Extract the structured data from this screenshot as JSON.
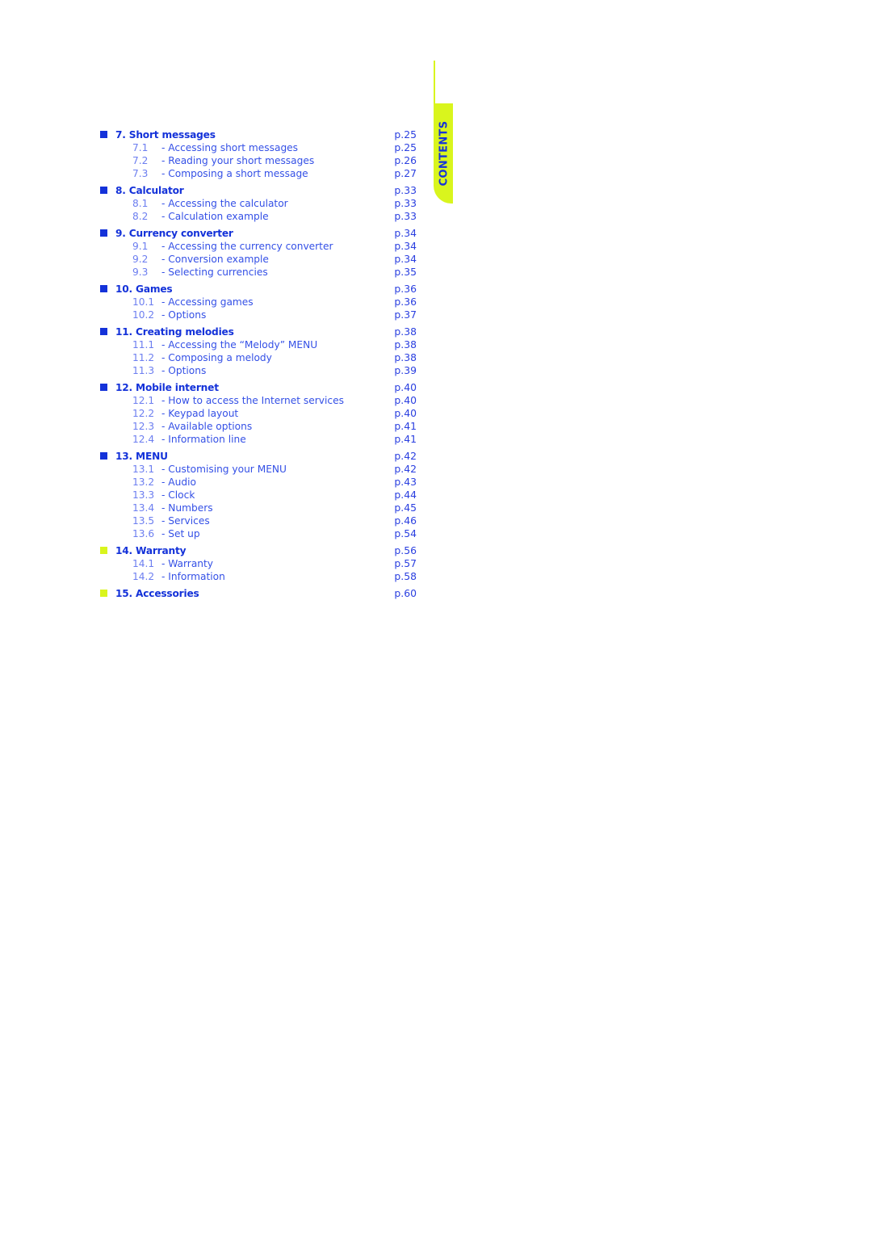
{
  "side_tab": {
    "label": "CONTENTS",
    "color": "#d9f51d",
    "text_color": "#1432d9"
  },
  "colors": {
    "primary_blue": "#1432d9",
    "sub_blue": "#3450e6",
    "accent_yellow": "#d9f51d"
  },
  "sections": [
    {
      "bullet": "blue",
      "title": "7. Short messages",
      "page": "p.25",
      "items": [
        {
          "num": "7.1",
          "label": "- Accessing short messages",
          "page": "p.25"
        },
        {
          "num": "7.2",
          "label": "- Reading your short messages",
          "page": "p.26"
        },
        {
          "num": "7.3",
          "label": "- Composing a short message",
          "page": "p.27"
        }
      ]
    },
    {
      "bullet": "blue",
      "title": "8. Calculator",
      "page": "p.33",
      "items": [
        {
          "num": "8.1",
          "label": "- Accessing the calculator",
          "page": "p.33"
        },
        {
          "num": "8.2",
          "label": "- Calculation example",
          "page": "p.33"
        }
      ]
    },
    {
      "bullet": "blue",
      "title": "9. Currency converter",
      "page": "p.34",
      "items": [
        {
          "num": "9.1",
          "label": "- Accessing the currency converter",
          "page": "p.34"
        },
        {
          "num": "9.2",
          "label": "- Conversion example",
          "page": "p.34"
        },
        {
          "num": "9.3",
          "label": "- Selecting currencies",
          "page": "p.35"
        }
      ]
    },
    {
      "bullet": "blue",
      "title": "10. Games",
      "page": "p.36",
      "items": [
        {
          "num": "10.1",
          "label": "- Accessing games",
          "page": "p.36"
        },
        {
          "num": "10.2",
          "label": "- Options",
          "page": "p.37"
        }
      ]
    },
    {
      "bullet": "blue",
      "title": "11. Creating melodies",
      "page": "p.38",
      "items": [
        {
          "num": "11.1",
          "label": "- Accessing the “Melody” MENU",
          "page": "p.38"
        },
        {
          "num": "11.2",
          "label": "- Composing a melody",
          "page": "p.38"
        },
        {
          "num": "11.3",
          "label": "- Options",
          "page": "p.39"
        }
      ]
    },
    {
      "bullet": "blue",
      "title": "12. Mobile internet",
      "page": "p.40",
      "items": [
        {
          "num": "12.1",
          "label": "- How to access the Internet services",
          "page": "p.40"
        },
        {
          "num": "12.2",
          "label": "- Keypad layout",
          "page": "p.40"
        },
        {
          "num": "12.3",
          "label": "- Available options",
          "page": "p.41"
        },
        {
          "num": "12.4",
          "label": "- Information line",
          "page": "p.41"
        }
      ]
    },
    {
      "bullet": "blue",
      "title": "13. MENU",
      "page": "p.42",
      "items": [
        {
          "num": "13.1",
          "label": "- Customising your MENU",
          "page": "p.42"
        },
        {
          "num": "13.2",
          "label": "- Audio",
          "page": "p.43"
        },
        {
          "num": "13.3",
          "label": "- Clock",
          "page": "p.44"
        },
        {
          "num": "13.4",
          "label": "- Numbers",
          "page": "p.45"
        },
        {
          "num": "13.5",
          "label": "- Services",
          "page": "p.46"
        },
        {
          "num": "13.6",
          "label": "- Set up",
          "page": "p.54"
        }
      ]
    },
    {
      "bullet": "yellow",
      "title": "14. Warranty",
      "page": "p.56",
      "items": [
        {
          "num": "14.1",
          "label": "- Warranty",
          "page": "p.57"
        },
        {
          "num": "14.2",
          "label": "- Information",
          "page": "p.58"
        }
      ]
    },
    {
      "bullet": "yellow",
      "title": "15. Accessories",
      "page": "p.60",
      "items": []
    }
  ]
}
